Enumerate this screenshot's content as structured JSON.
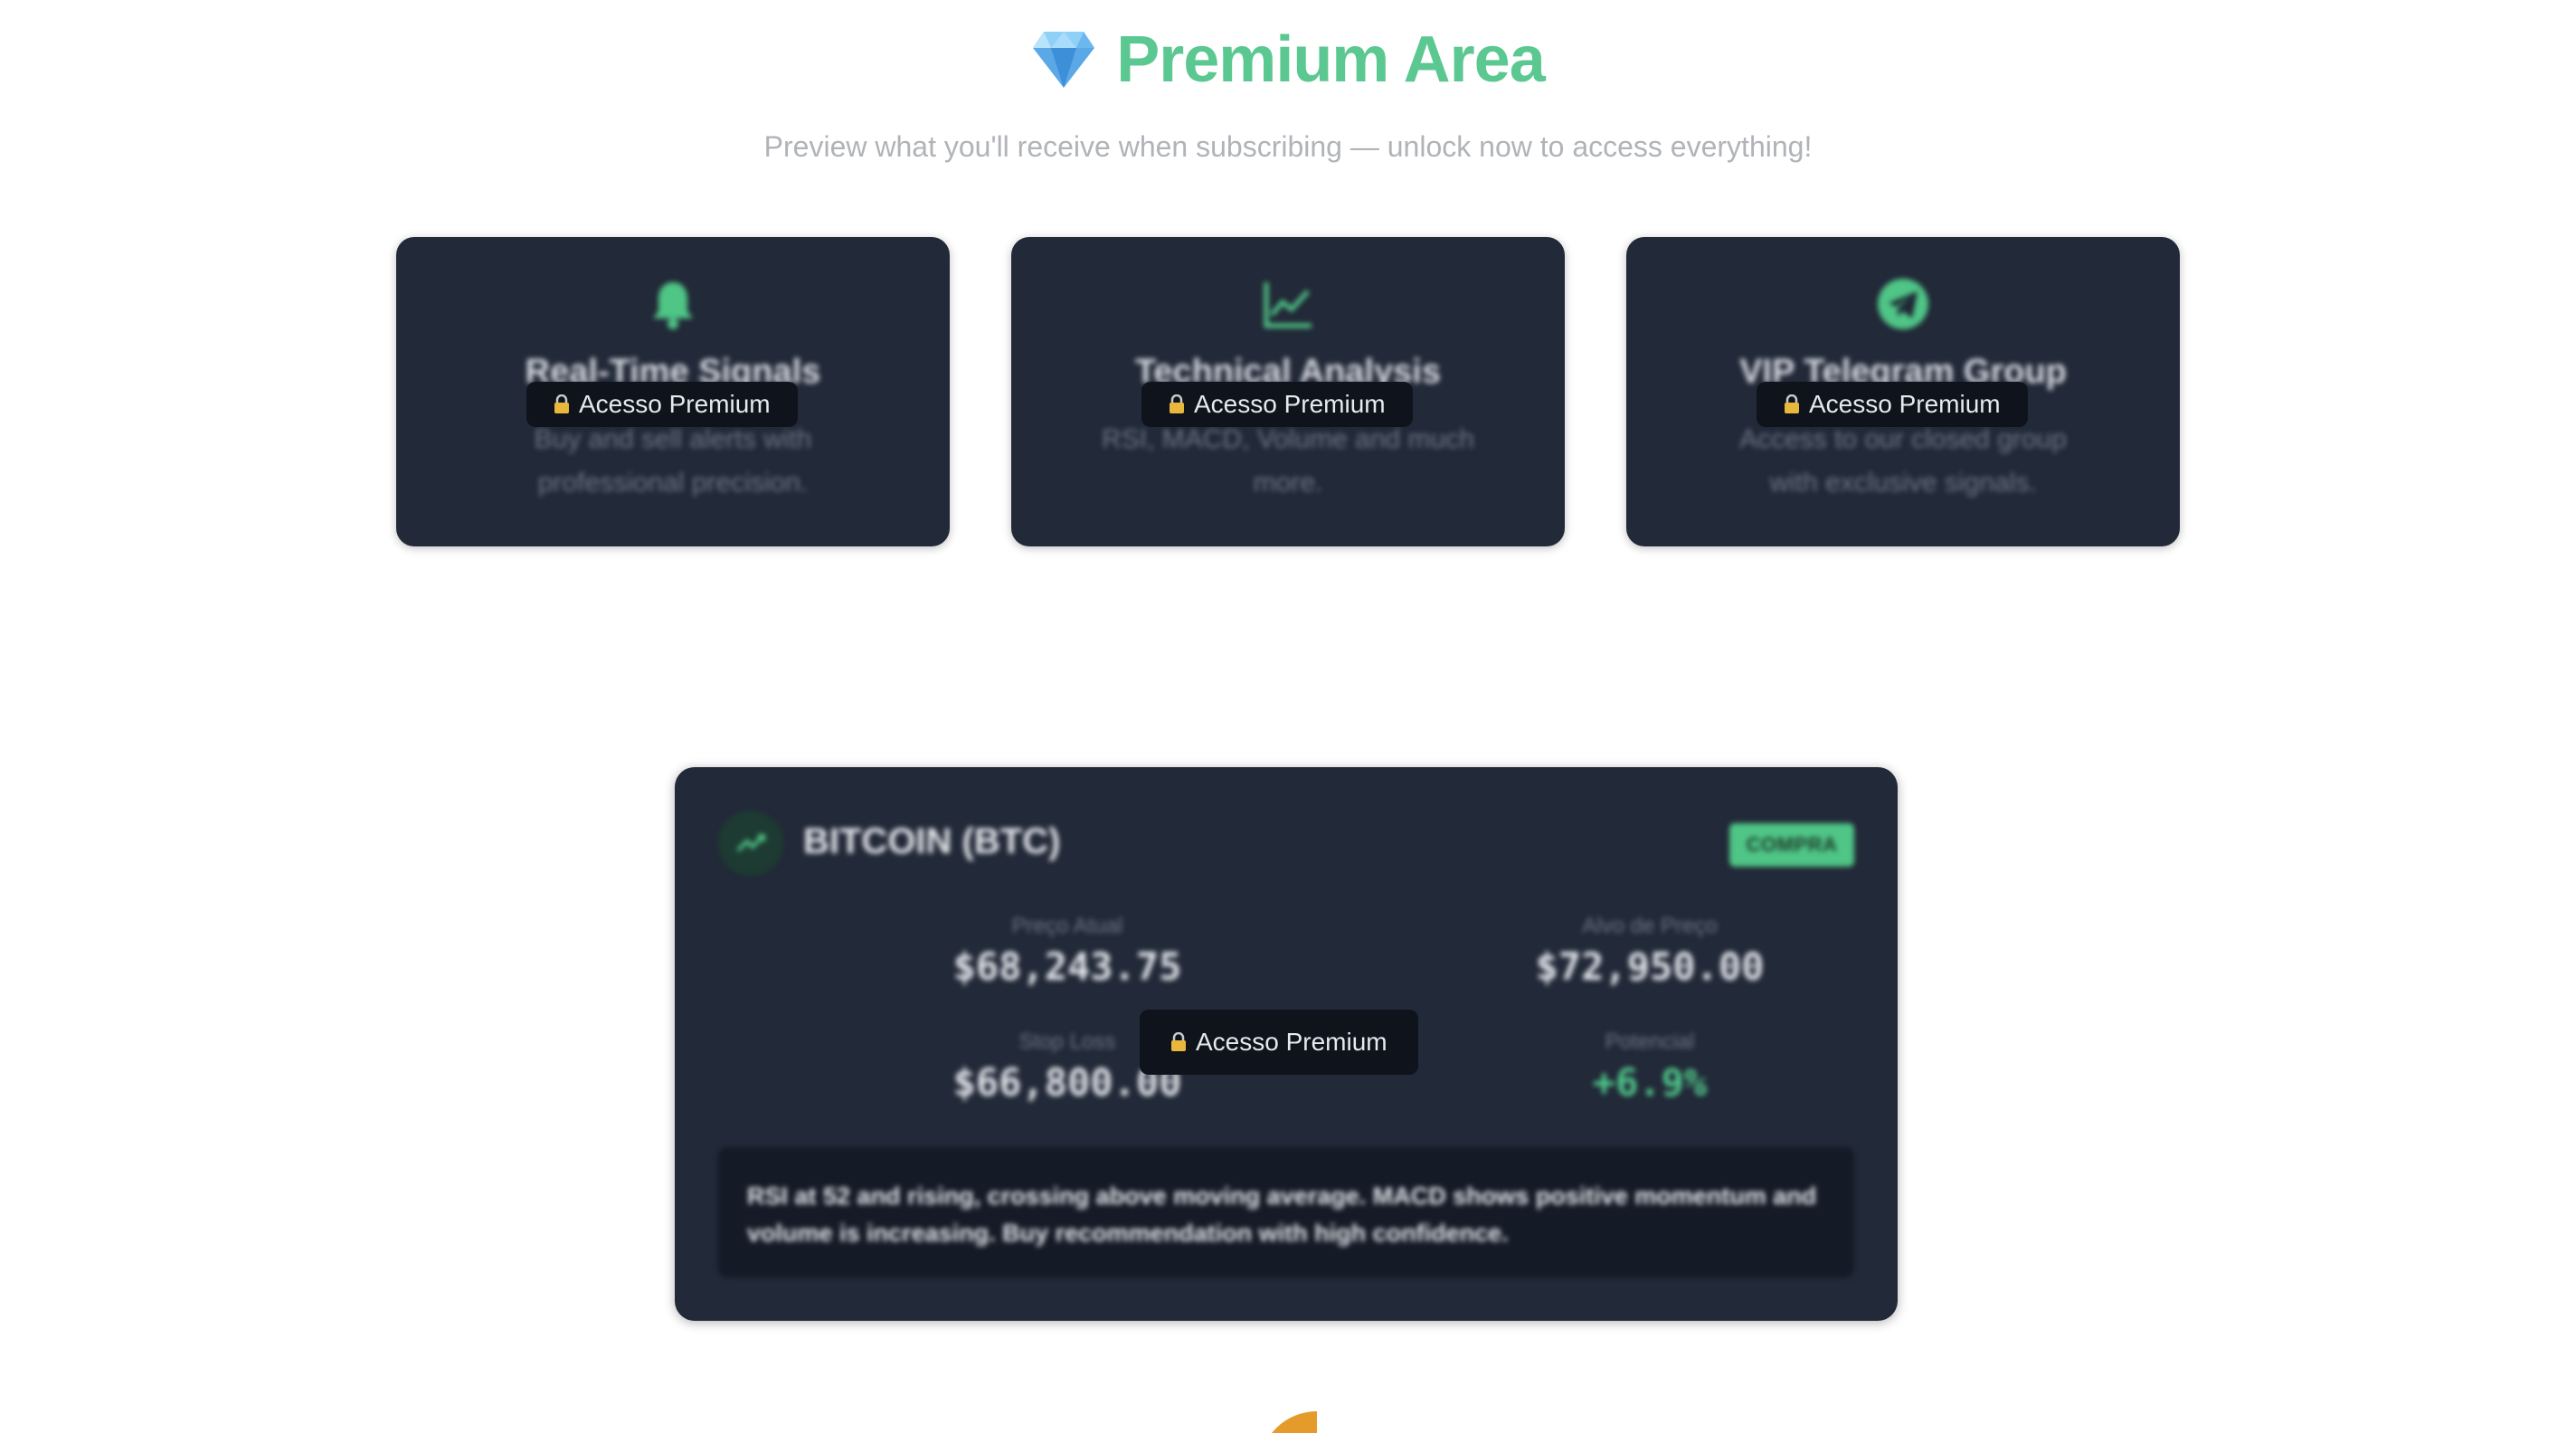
{
  "header": {
    "title": "Premium Area",
    "subtitle": "Preview what you'll receive when subscribing — unlock now to access everything!"
  },
  "lock_label": "Acesso Premium",
  "features": [
    {
      "icon": "bell-icon",
      "title": "Real-Time Signals",
      "description": "Buy and sell alerts with professional precision."
    },
    {
      "icon": "line-chart-icon",
      "title": "Technical Analysis",
      "description": "RSI, MACD, Volume and much more."
    },
    {
      "icon": "telegram-icon",
      "title": "VIP Telegram Group",
      "description": "Access to our closed group with exclusive signals."
    }
  ],
  "signal": {
    "coin": "BITCOIN (BTC)",
    "badge": "COMPRA",
    "current_price_label": "Preço Atual",
    "current_price": "$68,243.75",
    "target_label": "Alvo de Preço",
    "target": "$72,950.00",
    "stop_label": "Stop Loss",
    "stop": "$66,800.00",
    "potential_label": "Potencial",
    "potential": "+6.9%",
    "analysis": "RSI at 52 and rising, crossing above moving average. MACD shows positive momentum and volume is increasing. Buy recommendation with high confidence."
  },
  "colors": {
    "accent": "#5cc891",
    "card_bg": "#222938",
    "buy": "#4fc586",
    "orange": "#e59b2c"
  }
}
